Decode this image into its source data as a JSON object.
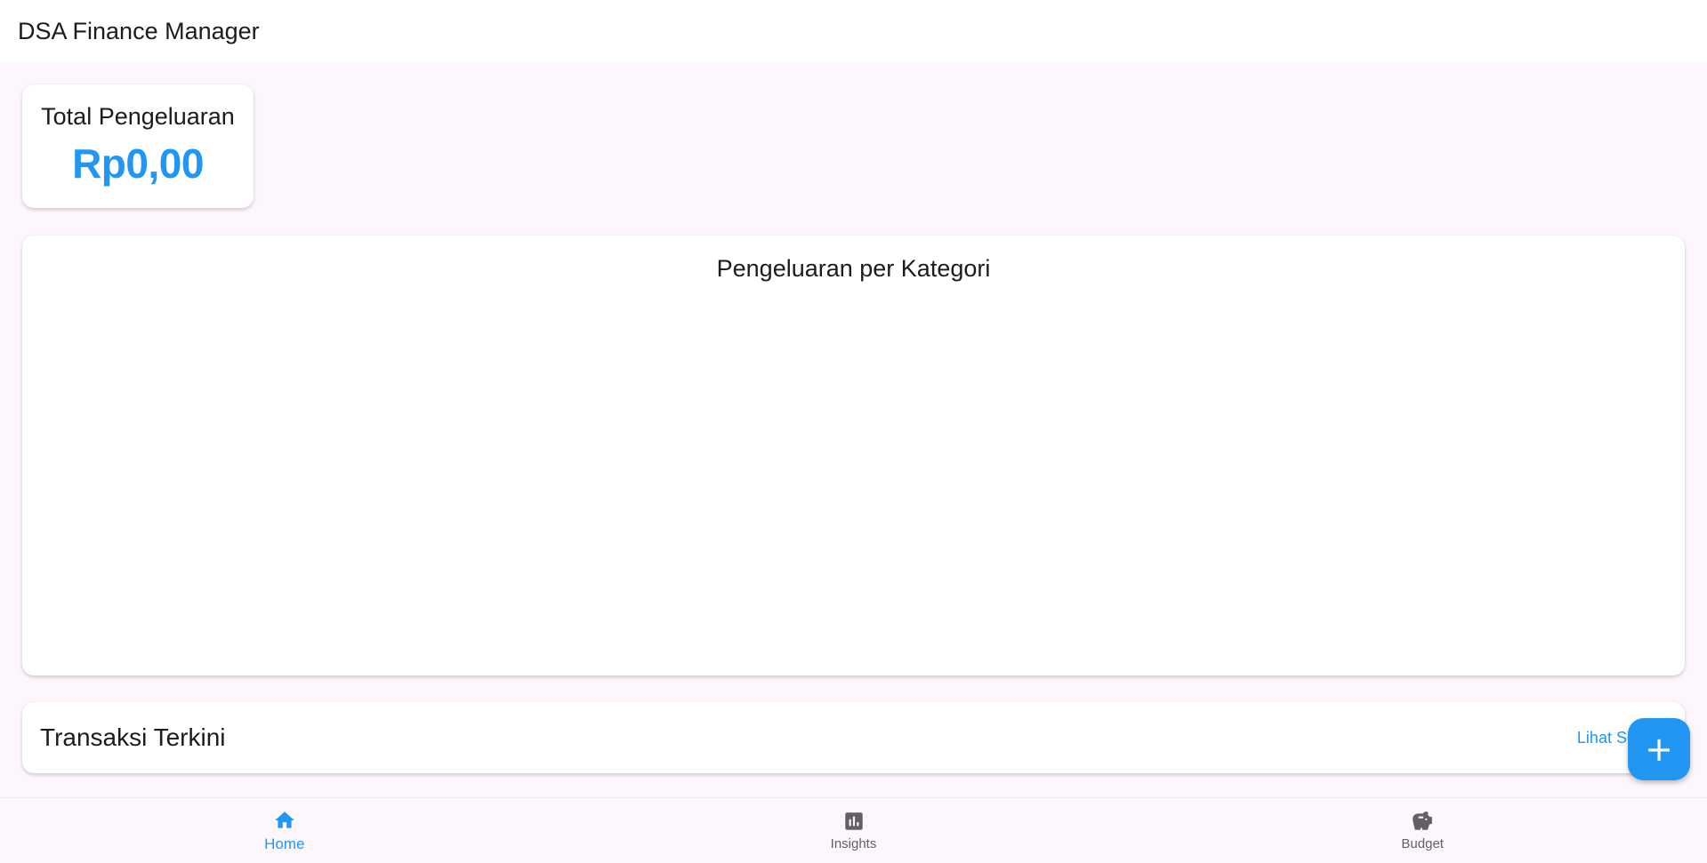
{
  "app": {
    "title": "DSA Finance Manager"
  },
  "summary": {
    "label": "Total Pengeluaran",
    "value": "Rp0,00"
  },
  "category_chart": {
    "title": "Pengeluaran per Kategori"
  },
  "transactions": {
    "title": "Transaksi Terkini",
    "see_all": "Lihat Semua"
  },
  "fab": {
    "icon": "plus-icon",
    "glyph": "+"
  },
  "bottom_nav": {
    "items": [
      {
        "label": "Home",
        "icon": "home-icon",
        "active": true
      },
      {
        "label": "Insights",
        "icon": "insights-icon",
        "active": false
      },
      {
        "label": "Budget",
        "icon": "savings-icon",
        "active": false
      }
    ]
  },
  "colors": {
    "accent": "#2196f3",
    "background": "#fdf7fd",
    "card": "#ffffff",
    "inactive_icon": "#616161"
  }
}
